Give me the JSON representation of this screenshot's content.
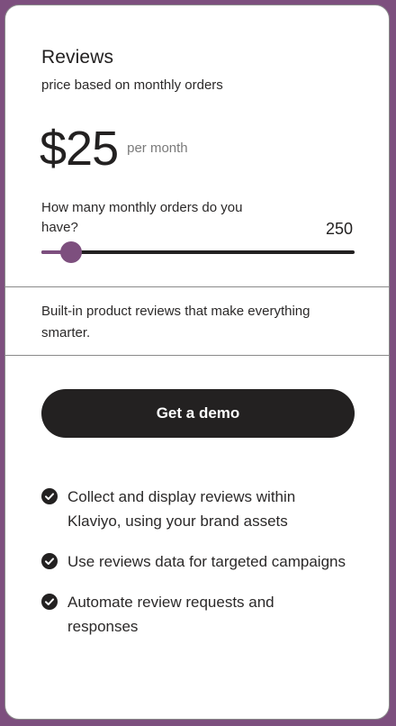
{
  "plan": {
    "title": "Reviews",
    "subtitle": "price based on monthly orders",
    "price": "$25",
    "price_period": "per month"
  },
  "slider": {
    "question": "How many monthly orders do you have?",
    "value": "250",
    "level_fraction": 0.095,
    "colors": {
      "filled": "#7d4f7e",
      "track": "#232121",
      "thumb": "#7d4f7e"
    }
  },
  "description": "Built-in product reviews that make everything smarter.",
  "cta": {
    "label": "Get a demo"
  },
  "features": [
    {
      "icon": "check-circle-icon",
      "text": "Collect and display reviews within Klaviyo, using your brand assets"
    },
    {
      "icon": "check-circle-icon",
      "text": "Use reviews data for targeted campaigns"
    },
    {
      "icon": "check-circle-icon",
      "text": "Automate review requests and responses"
    }
  ],
  "colors": {
    "background": "#7d4f7e",
    "card": "#ffffff",
    "text": "#232121",
    "button": "#232121"
  }
}
